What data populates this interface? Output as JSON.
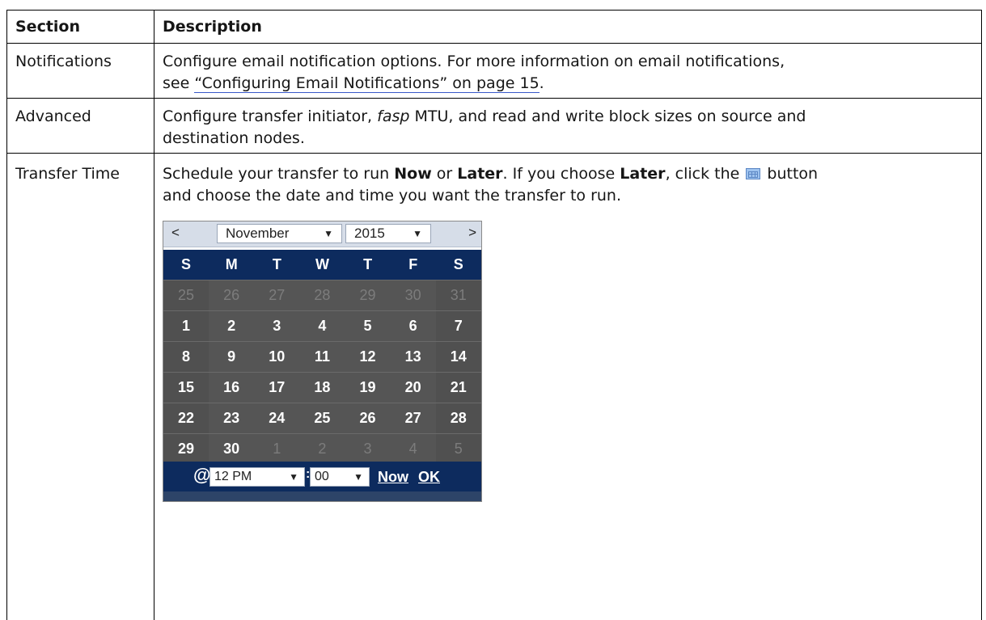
{
  "table": {
    "header": {
      "section": "Section",
      "description": "Description"
    },
    "rows": [
      {
        "section": "Notifications",
        "desc_line1": "Configure email notification options. For more information on email notifications,",
        "desc_line2_prefix": "see ",
        "desc_link": "“Configuring Email Notifications” on page 15",
        "desc_line2_suffix": "."
      },
      {
        "section": "Advanced",
        "desc_part1": "Configure transfer initiator, ",
        "desc_italic": "fasp",
        "desc_part2": " MTU, and read and write block sizes on source and",
        "desc_line2": "destination nodes."
      },
      {
        "section": "Transfer Time",
        "desc_a": "Schedule your transfer to run ",
        "desc_now": "Now",
        "desc_b": " or ",
        "desc_later": "Later",
        "desc_c": ". If you choose ",
        "desc_later2": "Later",
        "desc_d": ", click the ",
        "desc_e": " button",
        "desc_line2": "and choose the date and time you want the transfer to run."
      }
    ]
  },
  "calendar": {
    "prev": "<",
    "next": ">",
    "month": "November",
    "year": "2015",
    "dropdown_arrow": "▼",
    "weekdays": [
      "S",
      "M",
      "T",
      "W",
      "T",
      "F",
      "S"
    ],
    "weeks": [
      [
        "25",
        "26",
        "27",
        "28",
        "29",
        "30",
        "31"
      ],
      [
        "1",
        "2",
        "3",
        "4",
        "5",
        "6",
        "7"
      ],
      [
        "8",
        "9",
        "10",
        "11",
        "12",
        "13",
        "14"
      ],
      [
        "15",
        "16",
        "17",
        "18",
        "19",
        "20",
        "21"
      ],
      [
        "22",
        "23",
        "24",
        "25",
        "26",
        "27",
        "28"
      ],
      [
        "29",
        "30",
        "1",
        "2",
        "3",
        "4",
        "5"
      ]
    ],
    "at_symbol": "@",
    "hour": "12 PM",
    "colon": ":",
    "minute": "00",
    "now_link": "Now",
    "ok_link": "OK"
  }
}
